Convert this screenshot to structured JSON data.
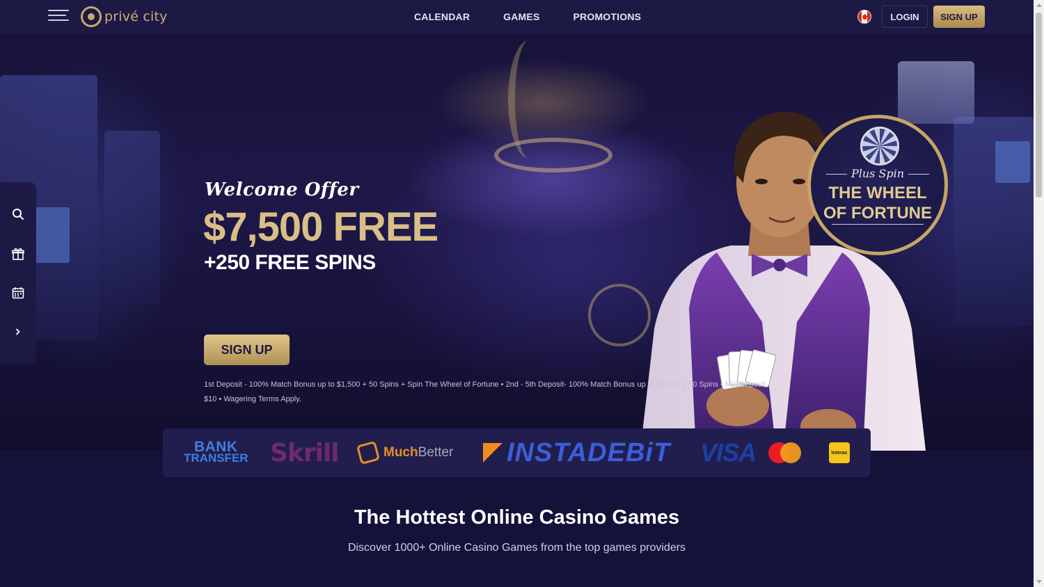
{
  "header": {
    "logo_text": "privé city",
    "nav": [
      "CALENDAR",
      "GAMES",
      "PROMOTIONS"
    ],
    "login_label": "LOGIN",
    "signup_label": "SIGN UP"
  },
  "hero": {
    "welcome": "Welcome Offer",
    "amount": "$7,500 FREE",
    "spins": "+250 FREE SPINS",
    "cta": "SIGN UP",
    "terms": "1st Deposit - 100% Match Bonus up to $1,500 + 50 Spins + Spin The Wheel of Fortune • 2nd - 5th Deposit- 100% Match Bonus up to $1,500 + 50 Spins • Min Deposit $10 • Wagering Terms Apply."
  },
  "badge": {
    "subtitle": "Plus Spin",
    "title_line1": "THE WHEEL",
    "title_line2": "OF FORTUNE"
  },
  "sidebar": {
    "items": [
      "search-icon",
      "gift-icon",
      "calendar-icon",
      "chevron-right-icon"
    ]
  },
  "payments": {
    "bank_line1": "BANK",
    "bank_line2": "TRANSFER",
    "skrill": "Skrill",
    "muchbetter_1": "Much",
    "muchbetter_2": "Better",
    "instadebit": "INSTADEBiT",
    "visa": "VISA",
    "interac": "Interac"
  },
  "section": {
    "title": "The Hottest Online Casino Games",
    "subtitle": "Discover 1000+ Online Casino Games from the top games providers"
  },
  "colors": {
    "background": "#15123a",
    "header": "#1c1945",
    "gold": "#d9bf87",
    "accent_button": "#c9a969"
  }
}
